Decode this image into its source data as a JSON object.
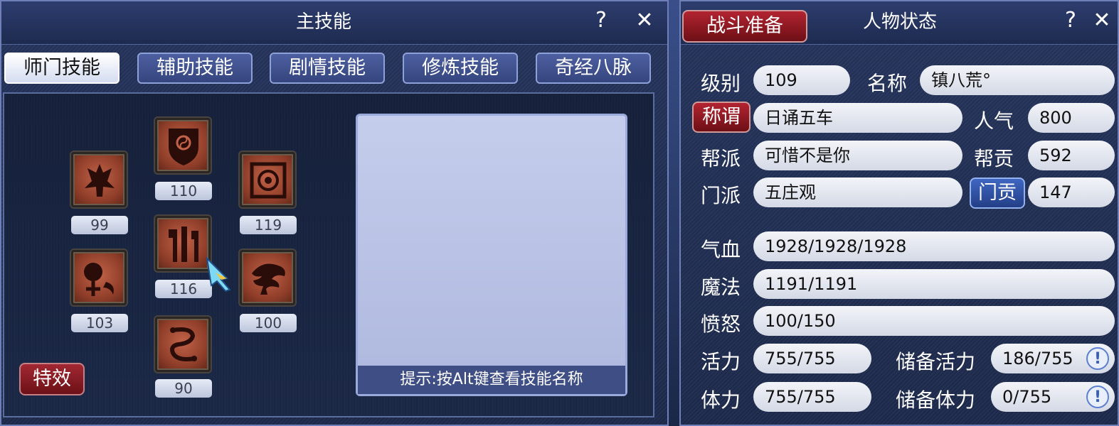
{
  "skills_window": {
    "title": "主技能",
    "help": "?",
    "close": "✕",
    "tabs": [
      "师门技能",
      "辅助技能",
      "剧情技能",
      "修炼技能",
      "奇经八脉"
    ],
    "active_tab": "师门技能",
    "skills": [
      {
        "icon": "winged-idol-icon",
        "level": "99"
      },
      {
        "icon": "yin-yang-shield-icon",
        "level": "110"
      },
      {
        "icon": "sealed-talisman-icon",
        "level": "119"
      },
      {
        "icon": "orb-crescent-icon",
        "level": "103"
      },
      {
        "icon": "pillars-icon",
        "level": "116"
      },
      {
        "icon": "bonsai-tree-icon",
        "level": "100"
      },
      {
        "icon": "chain-links-icon",
        "level": "90"
      }
    ],
    "hint": "提示:按Alt键查看技能名称",
    "effects_label": "特效"
  },
  "status_window": {
    "battle_prep": "战斗准备",
    "title": "人物状态",
    "help": "?",
    "close": "✕",
    "level_label": "级别",
    "level": "109",
    "name_label": "名称",
    "name": "镇八荒°",
    "title_btn": "称谓",
    "title_value": "日诵五车",
    "popularity_label": "人气",
    "popularity": "800",
    "gang_label": "帮派",
    "gang": "可惜不是你",
    "gang_contrib_label": "帮贡",
    "gang_contrib": "592",
    "sect_label": "门派",
    "sect": "五庄观",
    "sect_contrib_btn": "门贡",
    "sect_contrib": "147",
    "hp_label": "气血",
    "hp": "1928/1928/1928",
    "mp_label": "魔法",
    "mp": "1191/1191",
    "rage_label": "愤怒",
    "rage": "100/150",
    "vitality_label": "活力",
    "vitality": "755/755",
    "reserve_vitality_label": "储备活力",
    "reserve_vitality": "186/755",
    "stamina_label": "体力",
    "stamina": "755/755",
    "reserve_stamina_label": "储备体力",
    "reserve_stamina": "0/755",
    "info_icon": "!"
  }
}
